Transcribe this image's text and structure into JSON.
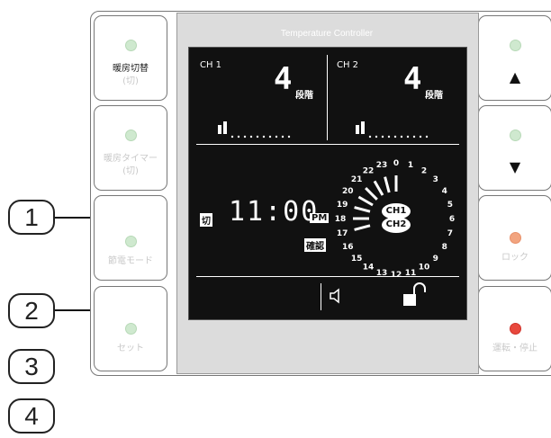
{
  "panel_title": "Temperature Controller",
  "left_buttons": [
    {
      "label_line1": "暖房切替",
      "label_line2": "(切)",
      "led": "green",
      "faint": false
    },
    {
      "label_line1": "暖房タイマー",
      "label_line2": "(切)",
      "led": "green",
      "faint": true
    },
    {
      "label_line1": "",
      "label_line2": "節電モード",
      "led": "green",
      "faint": true
    },
    {
      "label_line1": "",
      "label_line2": "セット",
      "led": "green",
      "faint": true
    }
  ],
  "right_buttons": [
    {
      "arrow": "▲",
      "label": "",
      "led": "green"
    },
    {
      "arrow": "▼",
      "label": "",
      "led": "green"
    },
    {
      "arrow": "",
      "label": "ロック",
      "led": "orange"
    },
    {
      "arrow": "",
      "label": "運転・停止",
      "led": "red"
    }
  ],
  "lcd": {
    "ch1_label": "CH 1",
    "ch2_label": "CH 2",
    "ch1_level_digit": "4",
    "ch2_level_digit": "4",
    "level_unit": "段階",
    "off_tag": "切",
    "time": "11:00",
    "pm": "PM",
    "confirm_tag": "確認",
    "dial_ch1": "CH1",
    "dial_ch2": "CH2",
    "hours": [
      "0",
      "1",
      "2",
      "3",
      "4",
      "5",
      "6",
      "7",
      "8",
      "9",
      "10",
      "11",
      "12",
      "13",
      "14",
      "15",
      "16",
      "17",
      "18",
      "19",
      "20",
      "21",
      "22",
      "23"
    ]
  },
  "callouts": [
    "1",
    "2",
    "3",
    "4"
  ],
  "colors": {
    "led_green": "#cfe9cf",
    "led_orange": "#f2a47f",
    "led_red": "#e8483d",
    "lcd_bg": "#111111",
    "panel_bg": "#dcdcdc"
  }
}
